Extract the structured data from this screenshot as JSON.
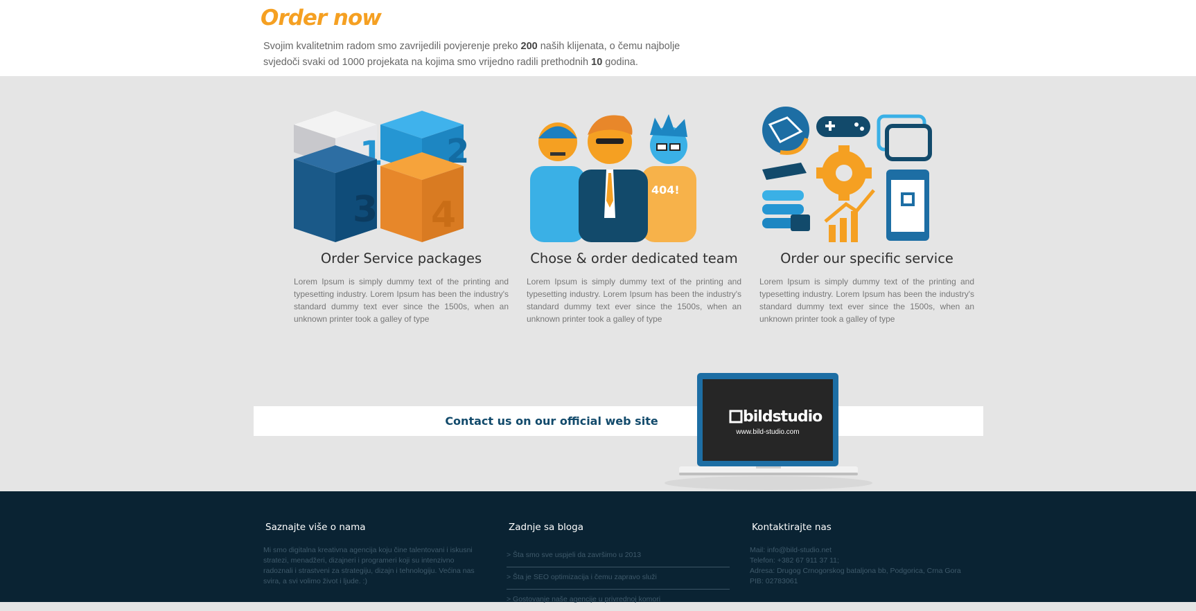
{
  "header": {
    "title": "Order now",
    "lead_part1": "Svojim kvalitetnim radom smo zavrijedili povjerenje preko ",
    "lead_num1": "200",
    "lead_part2": " naših klijenata, o čemu najbolje svjedoči svaki od 1000 projekata na kojima smo vrijedno radili prethodnih ",
    "lead_num2": "10",
    "lead_part3": " godina."
  },
  "services": [
    {
      "title": "Order Service packages",
      "text": "Lorem Ipsum is simply dummy text of the printing and typesetting industry. Lorem Ipsum has been the industry's standard dummy text ever since the 1500s, when an unknown printer took a galley of type",
      "icon": "numbered-boxes-icon",
      "box_labels": [
        "1",
        "2",
        "3",
        "4"
      ]
    },
    {
      "title": "Chose & order dedicated team",
      "text": "Lorem Ipsum is simply dummy text of the printing and typesetting industry. Lorem Ipsum has been the industry's standard dummy text ever since the 1500s, when an unknown printer took a galley of type",
      "icon": "team-people-icon",
      "shirt_text": "404!"
    },
    {
      "title": "Order our specific service",
      "text": "Lorem Ipsum is simply dummy text of the printing and typesetting industry. Lorem Ipsum has been the industry's standard dummy text ever since the 1500s, when an unknown printer took a galley of type",
      "icon": "services-collage-icon"
    }
  ],
  "contact": {
    "link_label": "Contact us on our official web site",
    "laptop_brand": "bildstudio",
    "laptop_url": "www.bild-studio.com"
  },
  "footer": {
    "about": {
      "heading": "Saznajte više o nama",
      "text": "Mi smo digitalna kreativna agencija koju čine talentovani i iskusni stratezi, menadžeri, dizajneri i programeri koji su intenzivno radoznali i strastveni za strategiju, dizajn i tehnologiju. Većina nas svira, a svi volimo život i ljude. :)"
    },
    "blog": {
      "heading": "Zadnje sa bloga",
      "items": [
        "> Šta smo sve uspjeli da završimo u 2013",
        "> Šta je SEO optimizacija i čemu zapravo služi",
        "> Gostovanje naše agencije u privrednoj komori"
      ]
    },
    "contact": {
      "heading": "Kontaktirajte nas",
      "mail_label": "Mail: ",
      "mail": "info@bild-studio.net",
      "phone": "Telefon: +382 67 911 37 11;",
      "address": "Adresa: Drugog Crnogorskog bataljona bb, Podgorica, Crna Gora",
      "pib": "PIB: 02783061"
    }
  },
  "colors": {
    "accent_orange": "#f5a022",
    "dark_blue": "#124a6b",
    "footer_bg": "#0a2333",
    "section_bg": "#e5e5e5"
  }
}
